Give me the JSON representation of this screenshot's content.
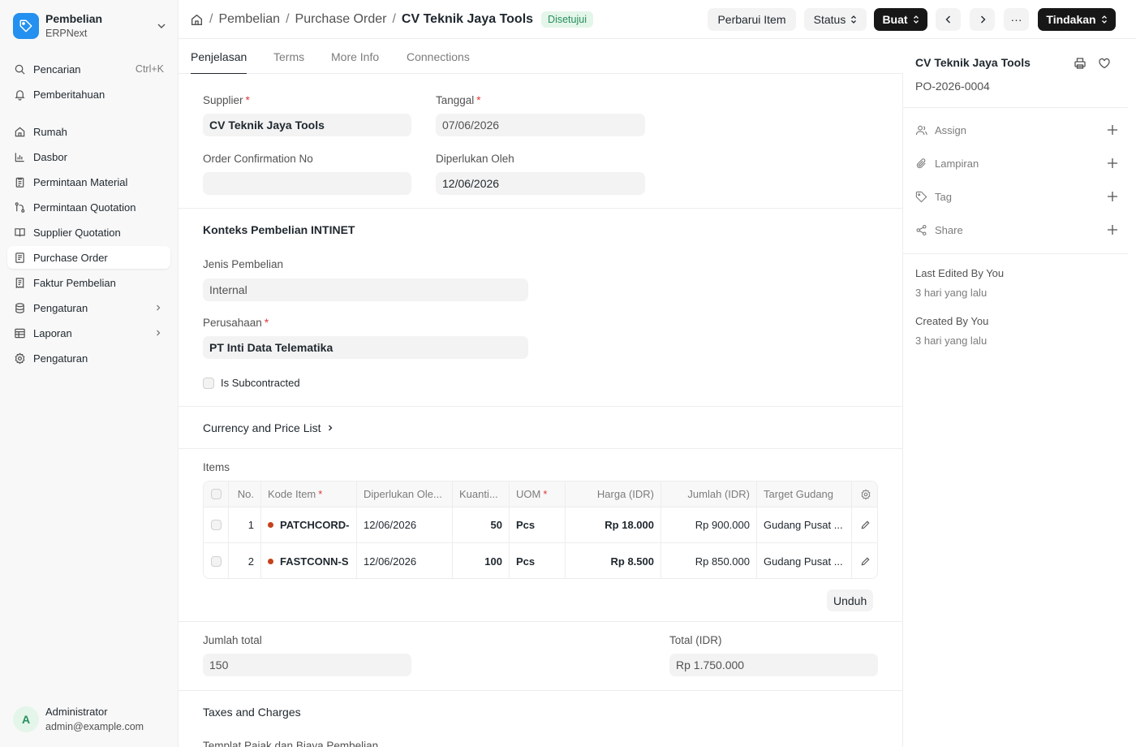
{
  "sidebar": {
    "app_title": "Pembelian",
    "app_subtitle": "ERPNext",
    "search_label": "Pencarian",
    "search_shortcut": "Ctrl+K",
    "notifications_label": "Pemberitahuan",
    "items": [
      {
        "label": "Rumah",
        "icon": "home-icon"
      },
      {
        "label": "Dasbor",
        "icon": "chart-icon"
      },
      {
        "label": "Permintaan Material",
        "icon": "clipboard-icon"
      },
      {
        "label": "Permintaan Quotation",
        "icon": "branch-icon"
      },
      {
        "label": "Supplier Quotation",
        "icon": "book-icon"
      },
      {
        "label": "Purchase Order",
        "icon": "file-icon",
        "active": true
      },
      {
        "label": "Faktur Pembelian",
        "icon": "invoice-icon"
      },
      {
        "label": "Pengaturan",
        "icon": "database-icon",
        "has_children": true
      },
      {
        "label": "Laporan",
        "icon": "table-icon",
        "has_children": true
      },
      {
        "label": "Pengaturan",
        "icon": "gear-icon"
      }
    ],
    "user": {
      "initial": "A",
      "name": "Administrator",
      "email": "admin@example.com"
    }
  },
  "header": {
    "breadcrumbs": [
      "Pembelian",
      "Purchase Order"
    ],
    "title": "CV Teknik Jaya Tools",
    "status": "Disetujui",
    "buttons": {
      "update_items": "Perbarui Item",
      "status": "Status",
      "create": "Buat",
      "more": "···",
      "actions": "Tindakan"
    }
  },
  "tabs": [
    "Penjelasan",
    "Terms",
    "More Info",
    "Connections"
  ],
  "form": {
    "supplier_label": "Supplier",
    "supplier_value": "CV Teknik Jaya Tools",
    "date_label": "Tanggal",
    "date_value": "07/06/2026",
    "order_conf_label": "Order Confirmation No",
    "order_conf_value": "",
    "required_by_label": "Diperlukan Oleh",
    "required_by_value": "12/06/2026",
    "context_section": "Konteks Pembelian INTINET",
    "purchase_type_label": "Jenis Pembelian",
    "purchase_type_value": "Internal",
    "company_label": "Perusahaan",
    "company_value": "PT Inti Data Telematika",
    "subcontracted_label": "Is Subcontracted",
    "currency_section": "Currency and Price List",
    "items_label": "Items",
    "download_label": "Unduh",
    "total_qty_label": "Jumlah total",
    "total_qty_value": "150",
    "total_label": "Total (IDR)",
    "total_value": "Rp 1.750.000",
    "taxes_section": "Taxes and Charges",
    "taxes_template_label": "Templat Pajak dan Biaya Pembelian"
  },
  "items_table": {
    "headers": [
      "No.",
      "Kode Item",
      "Diperlukan Ole...",
      "Kuanti...",
      "UOM",
      "Harga (IDR)",
      "Jumlah (IDR)",
      "Target Gudang"
    ],
    "rows": [
      {
        "no": "1",
        "item_code": "PATCHCORD-",
        "required_by": "12/06/2026",
        "qty": "50",
        "uom": "Pcs",
        "rate": "Rp 18.000",
        "amount": "Rp 900.000",
        "warehouse": "Gudang Pusat ..."
      },
      {
        "no": "2",
        "item_code": "FASTCONN-S",
        "required_by": "12/06/2026",
        "qty": "100",
        "uom": "Pcs",
        "rate": "Rp 8.500",
        "amount": "Rp 850.000",
        "warehouse": "Gudang Pusat ..."
      }
    ]
  },
  "right_panel": {
    "title": "CV Teknik Jaya Tools",
    "doc_id": "PO-2026-0004",
    "actions": [
      "Assign",
      "Lampiran",
      "Tag",
      "Share"
    ],
    "last_edited_label": "Last Edited By You",
    "last_edited_value": "3 hari yang lalu",
    "created_label": "Created By You",
    "created_value": "3 hari yang lalu"
  },
  "colors": {
    "accent": "#2490ef",
    "status_green": "#278f5e",
    "required_red": "#e03636",
    "item_dot": "#c4421a"
  }
}
